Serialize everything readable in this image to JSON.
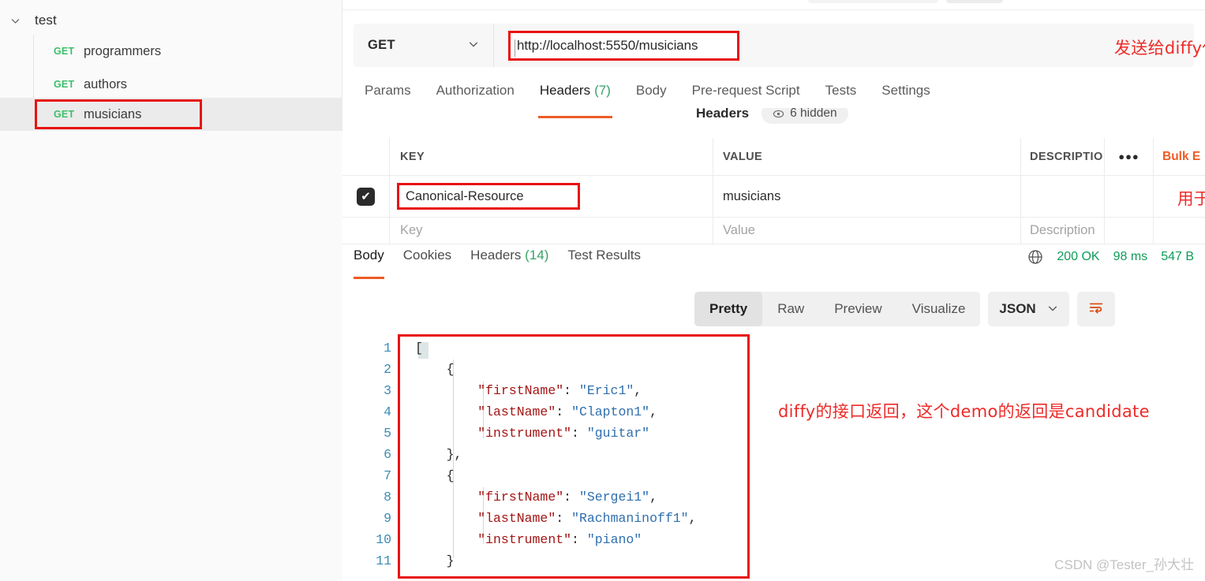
{
  "sidebar": {
    "collection": {
      "name": "test",
      "chevron_icon": "chevron-down-icon"
    },
    "requests": [
      {
        "method": "GET",
        "name": "programmers"
      },
      {
        "method": "GET",
        "name": "authors"
      },
      {
        "method": "GET",
        "name": "musicians"
      }
    ]
  },
  "request": {
    "method": "GET",
    "method_caret_icon": "chevron-down-icon",
    "url": "http://localhost:5550/musicians",
    "tabs": [
      {
        "label": "Params",
        "count": ""
      },
      {
        "label": "Authorization",
        "count": ""
      },
      {
        "label": "Headers",
        "count": "(7)"
      },
      {
        "label": "Body",
        "count": ""
      },
      {
        "label": "Pre-request Script",
        "count": ""
      },
      {
        "label": "Tests",
        "count": ""
      },
      {
        "label": "Settings",
        "count": ""
      }
    ],
    "active_tab": "Headers"
  },
  "headers_panel": {
    "title": "Headers",
    "hidden_pill": {
      "icon": "eye-icon",
      "label": "6 hidden"
    },
    "bulk_edit_label": "Bulk E",
    "more_icon": "ellipsis-icon",
    "columns": [
      "KEY",
      "VALUE",
      "DESCRIPTIO"
    ],
    "rows": [
      {
        "enabled": true,
        "key": "Canonical-Resource",
        "value": "musicians",
        "description": ""
      }
    ],
    "placeholder_row": {
      "key": "Key",
      "value": "Value",
      "description": "Description"
    }
  },
  "response": {
    "tabs": [
      {
        "label": "Body",
        "count": ""
      },
      {
        "label": "Cookies",
        "count": ""
      },
      {
        "label": "Headers",
        "count": "(14)"
      },
      {
        "label": "Test Results",
        "count": ""
      }
    ],
    "active_tab": "Body",
    "globe_icon": "globe-icon",
    "status": "200 OK",
    "time": "98 ms",
    "size": "547 B",
    "view_modes": [
      "Pretty",
      "Raw",
      "Preview",
      "Visualize"
    ],
    "active_view_mode": "Pretty",
    "format": "JSON",
    "format_caret_icon": "chevron-down-icon",
    "wrap_icon": "word-wrap-icon",
    "body_lines": [
      {
        "n": "1",
        "segments": [
          {
            "t": "[",
            "c": "p"
          }
        ]
      },
      {
        "n": "2",
        "segments": [
          {
            "t": "    {",
            "c": "p"
          }
        ]
      },
      {
        "n": "3",
        "segments": [
          {
            "t": "        ",
            "c": "p"
          },
          {
            "t": "\"firstName\"",
            "c": "k"
          },
          {
            "t": ": ",
            "c": "p"
          },
          {
            "t": "\"Eric1\"",
            "c": "s"
          },
          {
            "t": ",",
            "c": "p"
          }
        ]
      },
      {
        "n": "4",
        "segments": [
          {
            "t": "        ",
            "c": "p"
          },
          {
            "t": "\"lastName\"",
            "c": "k"
          },
          {
            "t": ": ",
            "c": "p"
          },
          {
            "t": "\"Clapton1\"",
            "c": "s"
          },
          {
            "t": ",",
            "c": "p"
          }
        ]
      },
      {
        "n": "5",
        "segments": [
          {
            "t": "        ",
            "c": "p"
          },
          {
            "t": "\"instrument\"",
            "c": "k"
          },
          {
            "t": ": ",
            "c": "p"
          },
          {
            "t": "\"guitar\"",
            "c": "s"
          }
        ]
      },
      {
        "n": "6",
        "segments": [
          {
            "t": "    },",
            "c": "p"
          }
        ]
      },
      {
        "n": "7",
        "segments": [
          {
            "t": "    {",
            "c": "p"
          }
        ]
      },
      {
        "n": "8",
        "segments": [
          {
            "t": "        ",
            "c": "p"
          },
          {
            "t": "\"firstName\"",
            "c": "k"
          },
          {
            "t": ": ",
            "c": "p"
          },
          {
            "t": "\"Sergei1\"",
            "c": "s"
          },
          {
            "t": ",",
            "c": "p"
          }
        ]
      },
      {
        "n": "9",
        "segments": [
          {
            "t": "        ",
            "c": "p"
          },
          {
            "t": "\"lastName\"",
            "c": "k"
          },
          {
            "t": ": ",
            "c": "p"
          },
          {
            "t": "\"Rachmaninoff1\"",
            "c": "s"
          },
          {
            "t": ",",
            "c": "p"
          }
        ]
      },
      {
        "n": "10",
        "segments": [
          {
            "t": "        ",
            "c": "p"
          },
          {
            "t": "\"instrument\"",
            "c": "k"
          },
          {
            "t": ": ",
            "c": "p"
          },
          {
            "t": "\"piano\"",
            "c": "s"
          }
        ]
      },
      {
        "n": "11",
        "segments": [
          {
            "t": "    }",
            "c": "p"
          }
        ]
      }
    ]
  },
  "annotations": [
    {
      "text": "发送给diffy代理"
    },
    {
      "text": "用于标识展示报告"
    },
    {
      "text": "diffy的接口返回，这个demo的返回是candidate"
    }
  ],
  "watermark": "CSDN @Tester_孙大壮",
  "colors": {
    "accent_orange": "#ef5b25",
    "success_green": "#0f9d58",
    "method_green": "#3cc069",
    "annotation_red": "#ed2b28",
    "highlight_box": "#e8130f"
  }
}
